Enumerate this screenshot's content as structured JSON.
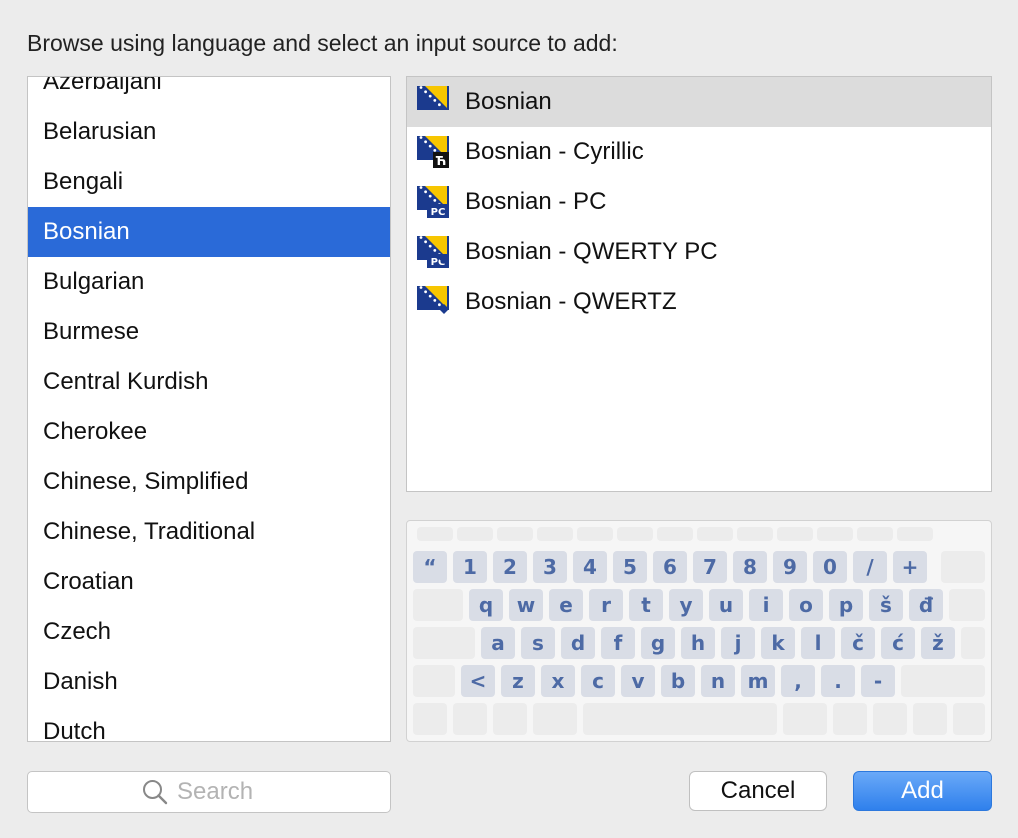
{
  "header": "Browse using language and select an input source to add:",
  "languages": [
    "Azerbaijani",
    "Belarusian",
    "Bengali",
    "Bosnian",
    "Bulgarian",
    "Burmese",
    "Central Kurdish",
    "Cherokee",
    "Chinese, Simplified",
    "Chinese, Traditional",
    "Croatian",
    "Czech",
    "Danish",
    "Dutch"
  ],
  "selected_language": "Bosnian",
  "sources": [
    {
      "label": "Bosnian",
      "badge": ""
    },
    {
      "label": "Bosnian - Cyrillic",
      "badge": "Ћ"
    },
    {
      "label": "Bosnian - PC",
      "badge": "PC"
    },
    {
      "label": "Bosnian - QWERTY PC",
      "badge": "PC"
    },
    {
      "label": "Bosnian - QWERTZ",
      "badge": ""
    }
  ],
  "keyboard": {
    "row1": [
      "“",
      "1",
      "2",
      "3",
      "4",
      "5",
      "6",
      "7",
      "8",
      "9",
      "0",
      "/",
      "+"
    ],
    "row2": [
      "q",
      "w",
      "e",
      "r",
      "t",
      "y",
      "u",
      "i",
      "o",
      "p",
      "š",
      "đ"
    ],
    "row3": [
      "a",
      "s",
      "d",
      "f",
      "g",
      "h",
      "j",
      "k",
      "l",
      "č",
      "ć",
      "ž"
    ],
    "row4": [
      "<",
      "z",
      "x",
      "c",
      "v",
      "b",
      "n",
      "m",
      ",",
      ".",
      "-"
    ]
  },
  "search": {
    "placeholder": "Search",
    "value": ""
  },
  "buttons": {
    "cancel": "Cancel",
    "add": "Add"
  },
  "colors": {
    "selection": "#2a6ad8",
    "add_button": "#3b86f0",
    "key_text": "#4d6aa5",
    "flag_blue": "#1b3a8e",
    "flag_yellow": "#f7c600"
  }
}
